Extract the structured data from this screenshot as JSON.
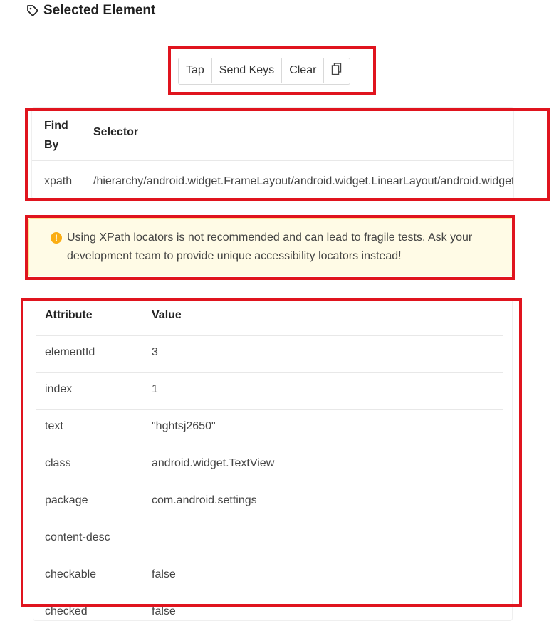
{
  "panel": {
    "title": "Selected Element",
    "icon": "tag-icon"
  },
  "actions": {
    "tap": "Tap",
    "send_keys": "Send Keys",
    "clear": "Clear",
    "copy_icon": "copy-icon"
  },
  "selector_table": {
    "headers": {
      "find_by": "Find By",
      "selector": "Selector"
    },
    "rows": [
      {
        "find_by": "xpath",
        "selector": "/hierarchy/android.widget.FrameLayout/android.widget.LinearLayout/android.widget.FrameLayout"
      }
    ]
  },
  "warning": {
    "text": "Using XPath locators is not recommended and can lead to fragile tests. Ask your development team to provide unique accessibility locators instead!"
  },
  "attributes": {
    "headers": {
      "attribute": "Attribute",
      "value": "Value"
    },
    "rows": [
      {
        "attribute": "elementId",
        "value": "3"
      },
      {
        "attribute": "index",
        "value": "1"
      },
      {
        "attribute": "text",
        "value": "\"hghtsj2650\""
      },
      {
        "attribute": "class",
        "value": "android.widget.TextView"
      },
      {
        "attribute": "package",
        "value": "com.android.settings"
      },
      {
        "attribute": "content-desc",
        "value": ""
      },
      {
        "attribute": "checkable",
        "value": "false"
      },
      {
        "attribute": "checked",
        "value": "false"
      }
    ]
  },
  "colors": {
    "highlight": "#e0141e",
    "warning_bg": "#fffbe6",
    "warning_icon": "#faad14"
  }
}
